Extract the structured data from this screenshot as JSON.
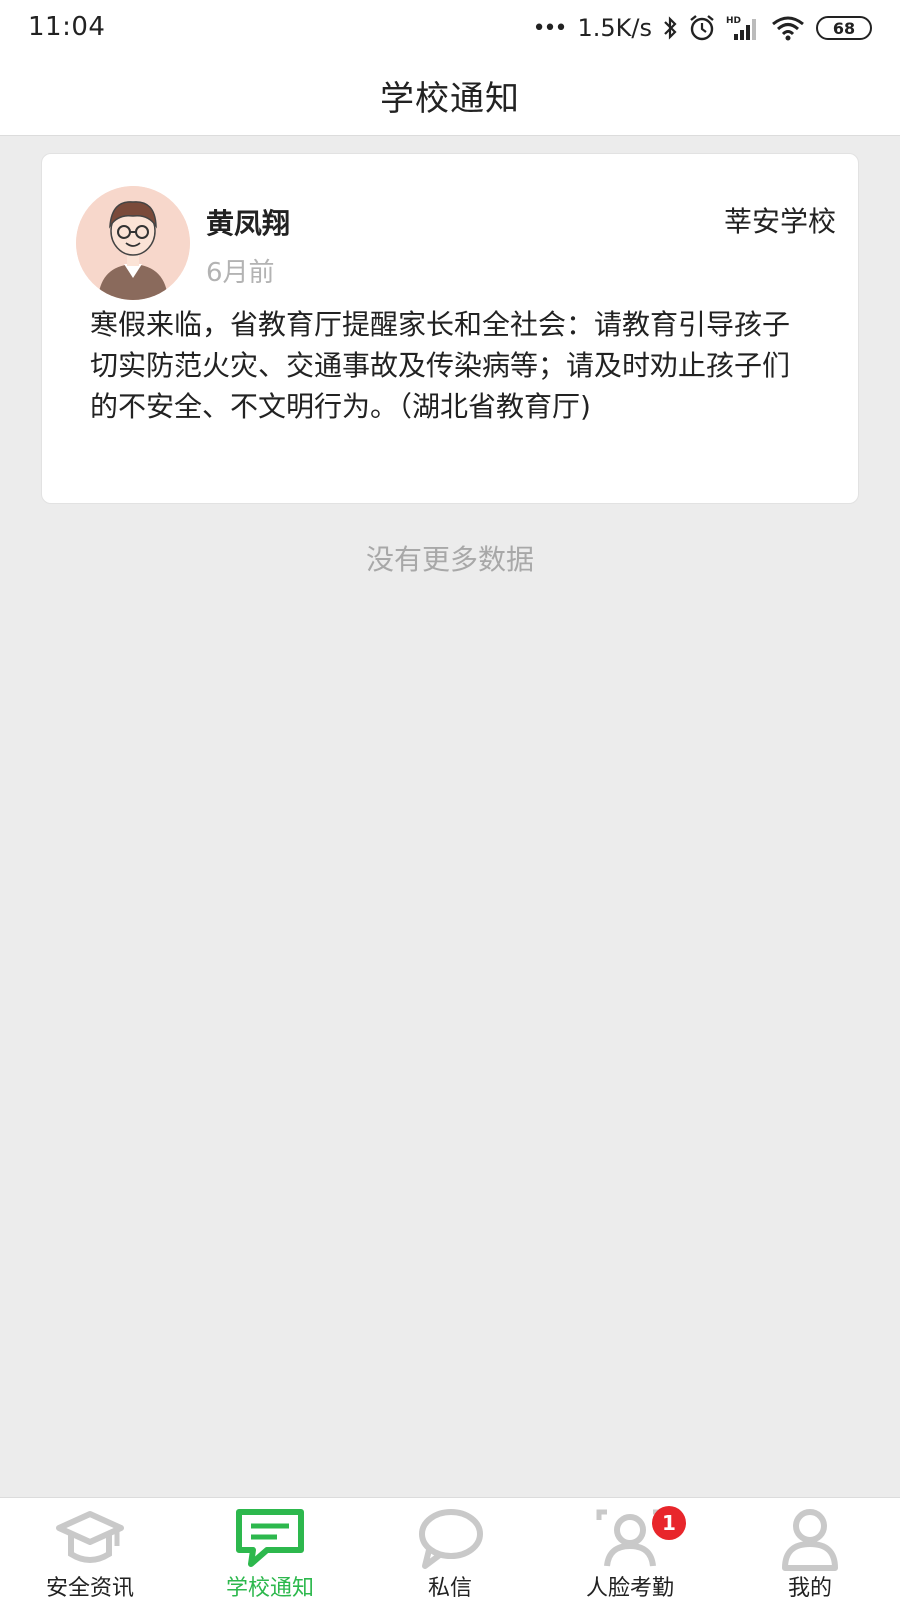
{
  "status_bar": {
    "time": "11:04",
    "net_speed": "1.5K/s",
    "battery": "68",
    "icons": [
      "dots-icon",
      "bluetooth-icon",
      "alarm-icon",
      "hd-signal-icon",
      "wifi-icon",
      "battery-icon"
    ]
  },
  "header": {
    "title": "学校通知"
  },
  "notice": {
    "author": "黄凤翔",
    "time": "6月前",
    "school": "莘安学校",
    "body": "寒假来临，省教育厅提醒家长和全社会：请教育引导孩子切实防范火灾、交通事故及传染病等；请及时劝止孩子们的不安全、不文明行为。（湖北省教育厅)"
  },
  "list_footer": "没有更多数据",
  "bottom_nav": {
    "items": [
      {
        "label": "安全资讯",
        "icon": "graduation-cap-icon",
        "active": false
      },
      {
        "label": "学校通知",
        "icon": "message-icon",
        "active": true
      },
      {
        "label": "私信",
        "icon": "chat-bubble-icon",
        "active": false
      },
      {
        "label": "人脸考勤",
        "icon": "face-attendance-icon",
        "active": false,
        "badge": "1"
      },
      {
        "label": "我的",
        "icon": "user-icon",
        "active": false
      }
    ]
  },
  "colors": {
    "accent": "#2db84d",
    "inactive_icon": "#c9c9c9",
    "badge": "#e8262b",
    "background": "#ececec"
  }
}
